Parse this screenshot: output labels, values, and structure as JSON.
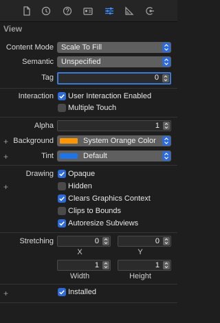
{
  "toolbar": {
    "icons": [
      "file-icon",
      "history-icon",
      "help-icon",
      "identity-card-icon",
      "attributes-sliders-icon",
      "size-ruler-icon",
      "connections-arrow-icon"
    ]
  },
  "section": {
    "title": "View"
  },
  "content_mode": {
    "label": "Content Mode",
    "value": "Scale To Fill"
  },
  "semantic": {
    "label": "Semantic",
    "value": "Unspecified"
  },
  "tag": {
    "label": "Tag",
    "value": "0"
  },
  "interaction": {
    "label": "Interaction",
    "user_interaction": {
      "label": "User Interaction Enabled",
      "checked": true
    },
    "multiple_touch": {
      "label": "Multiple Touch",
      "checked": false
    }
  },
  "alpha": {
    "label": "Alpha",
    "value": "1"
  },
  "background": {
    "label": "Background",
    "value": "System Orange Color",
    "color": "#ff9500"
  },
  "tint": {
    "label": "Tint",
    "value": "Default",
    "color": "#1f74e8"
  },
  "drawing": {
    "label": "Drawing",
    "opaque": {
      "label": "Opaque",
      "checked": true
    },
    "hidden": {
      "label": "Hidden",
      "checked": false
    },
    "clears_graphics": {
      "label": "Clears Graphics Context",
      "checked": true
    },
    "clips_to_bounds": {
      "label": "Clips to Bounds",
      "checked": false
    },
    "autoresize": {
      "label": "Autoresize Subviews",
      "checked": true
    }
  },
  "stretching": {
    "label": "Stretching",
    "x": {
      "label": "X",
      "value": "0"
    },
    "y": {
      "label": "Y",
      "value": "0"
    },
    "width": {
      "label": "Width",
      "value": "1"
    },
    "height": {
      "label": "Height",
      "value": "1"
    }
  },
  "installed": {
    "label": "Installed",
    "checked": true
  },
  "plus_glyph": "+",
  "colors": {
    "accent": "#2f6bd8",
    "background": "#1e1e1e"
  }
}
